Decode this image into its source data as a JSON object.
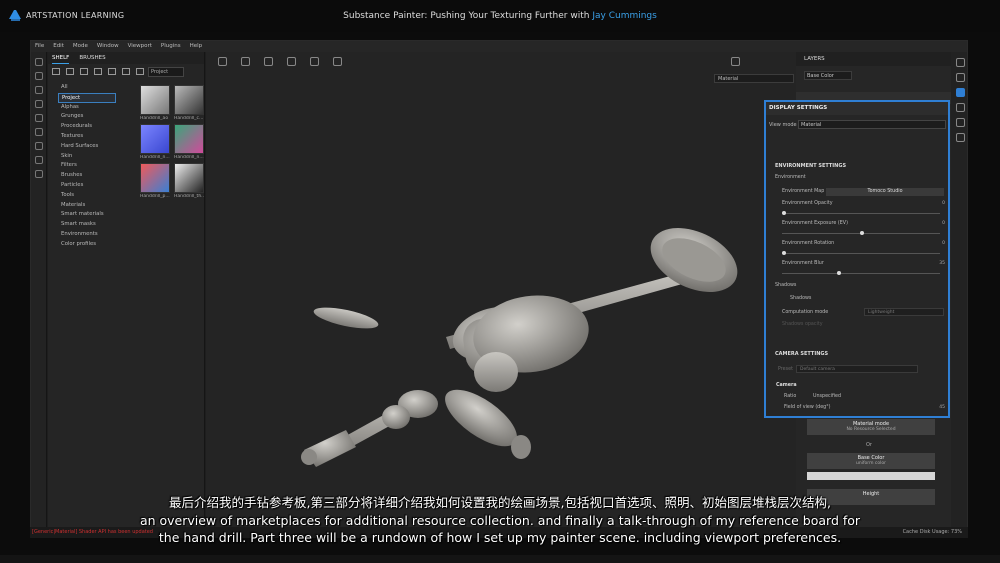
{
  "header": {
    "brand": "ARTSTATION LEARNING",
    "course_title": "Substance Painter: Pushing Your Texturing Further",
    "course_with": "with",
    "course_author": "Jay Cummings"
  },
  "menu": [
    "File",
    "Edit",
    "Mode",
    "Window",
    "Viewport",
    "Plugins",
    "Help"
  ],
  "shelf": {
    "tabs": [
      "SHELF",
      "BRUSHES"
    ],
    "search_chip": "Project",
    "categories": [
      "All",
      "Project",
      "Alphas",
      "Grunges",
      "Procedurals",
      "Textures",
      "Hard Surfaces",
      "Skin",
      "Filters",
      "Brushes",
      "Particles",
      "Tools",
      "Materials",
      "Smart materials",
      "Smart masks",
      "Environments",
      "Color profiles"
    ],
    "selected_category": "Project",
    "thumbnails": [
      "Handdrill_ao",
      "Handdrill_c...",
      "Handdrill_n...",
      "Handdrill_n...",
      "Handdrill_p...",
      "Handdrill_th..."
    ]
  },
  "viewport": {
    "mode_select": "Material"
  },
  "layers": {
    "title": "LAYERS",
    "channel": "Base Color",
    "blend": "Norm"
  },
  "display_settings": {
    "title": "DISPLAY SETTINGS",
    "view_mode_label": "View mode",
    "view_mode_value": "Material",
    "environment_section": "ENVIRONMENT SETTINGS",
    "environment_label": "Environment",
    "env_map_label": "Environment Map",
    "env_map_value": "Tomoco Studio",
    "env_opacity_label": "Environment Opacity",
    "env_opacity_value": "0",
    "env_exposure_label": "Environment Exposure (EV)",
    "env_exposure_value": "0",
    "env_rotation_label": "Environment Rotation",
    "env_rotation_value": "0",
    "env_blur_label": "Environment Blur",
    "env_blur_value": "35",
    "shadows_label": "Shadows",
    "shadows_check": "Shadows",
    "computation_mode_label": "Computation mode",
    "computation_mode_value": "Lightweight",
    "shadows_opacity_label": "Shadows opacity",
    "camera_section": "CAMERA SETTINGS",
    "preset_label": "Preset",
    "preset_value": "Default camera",
    "camera_label": "Camera",
    "ratio_label": "Ratio",
    "ratio_value": "Unspecified",
    "fov_label": "Field of view (deg°)",
    "fov_value": "45"
  },
  "channels": {
    "material_mode": "Material mode",
    "material_mode_sub": "No Resource Selected",
    "or": "Or",
    "base_color": "Base Color",
    "base_color_sub": "uniform color",
    "height": "Height"
  },
  "status": {
    "error": "[Generic|Material] Shader API has been updated",
    "cache": "Cache Disk Usage:  73%"
  },
  "subtitles": {
    "line1": "最后介绍我的手钻参考板,第三部分将详细介绍我如何设置我的绘画场景,包括视口首选项、照明、初始图层堆栈层次结构,",
    "line2": "an overview of marketplaces for additional resource collection. and finally a talk-through of my reference board for",
    "line3": "the hand drill. Part three will be a rundown of how I set up my painter scene. including viewport preferences."
  }
}
